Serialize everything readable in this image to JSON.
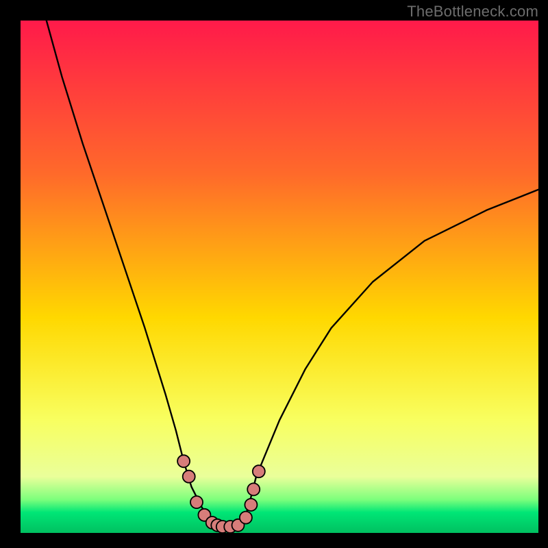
{
  "watermark": "TheBottleneck.com",
  "colors": {
    "frame": "#000000",
    "gradient_top": "#ff1a4a",
    "gradient_mid1": "#ff6a2a",
    "gradient_mid2": "#ffd800",
    "gradient_low": "#f8ff60",
    "gradient_green_top": "#7cff7c",
    "gradient_green_mid": "#00e676",
    "gradient_green_bot": "#00c060",
    "curve": "#000000",
    "marker_fill": "#d77d7a",
    "marker_stroke": "#000000"
  },
  "chart_data": {
    "type": "line",
    "title": "",
    "xlabel": "",
    "ylabel": "",
    "xlim": [
      0,
      100
    ],
    "ylim": [
      0,
      100
    ],
    "series": [
      {
        "name": "bottleneck-curve",
        "x": [
          5,
          8,
          12,
          16,
          20,
          24,
          28,
          30,
          31.5,
          33,
          35,
          37,
          39,
          41,
          43,
          44,
          45.5,
          50,
          55,
          60,
          68,
          78,
          90,
          100
        ],
        "values": [
          100,
          89,
          76,
          64,
          52,
          40,
          27,
          20,
          14,
          9,
          5,
          2,
          1.2,
          1.2,
          2.5,
          5,
          11,
          22,
          32,
          40,
          49,
          57,
          63,
          67
        ]
      }
    ],
    "markers": [
      {
        "name": "left-1",
        "x": 31.5,
        "y": 14
      },
      {
        "name": "left-2",
        "x": 32.5,
        "y": 11
      },
      {
        "name": "left-3",
        "x": 34.0,
        "y": 6
      },
      {
        "name": "left-4",
        "x": 35.5,
        "y": 3.5
      },
      {
        "name": "left-5",
        "x": 37.0,
        "y": 2
      },
      {
        "name": "left-6",
        "x": 38.0,
        "y": 1.5
      },
      {
        "name": "bot-1",
        "x": 39.0,
        "y": 1.2
      },
      {
        "name": "bot-2",
        "x": 40.5,
        "y": 1.2
      },
      {
        "name": "bot-3",
        "x": 42.0,
        "y": 1.5
      },
      {
        "name": "right-1",
        "x": 43.5,
        "y": 3.0
      },
      {
        "name": "right-2",
        "x": 44.5,
        "y": 5.5
      },
      {
        "name": "right-3",
        "x": 45.0,
        "y": 8.5
      },
      {
        "name": "right-4",
        "x": 46.0,
        "y": 12
      }
    ],
    "marker_radius_px": 9,
    "green_band_fraction": 0.07
  }
}
